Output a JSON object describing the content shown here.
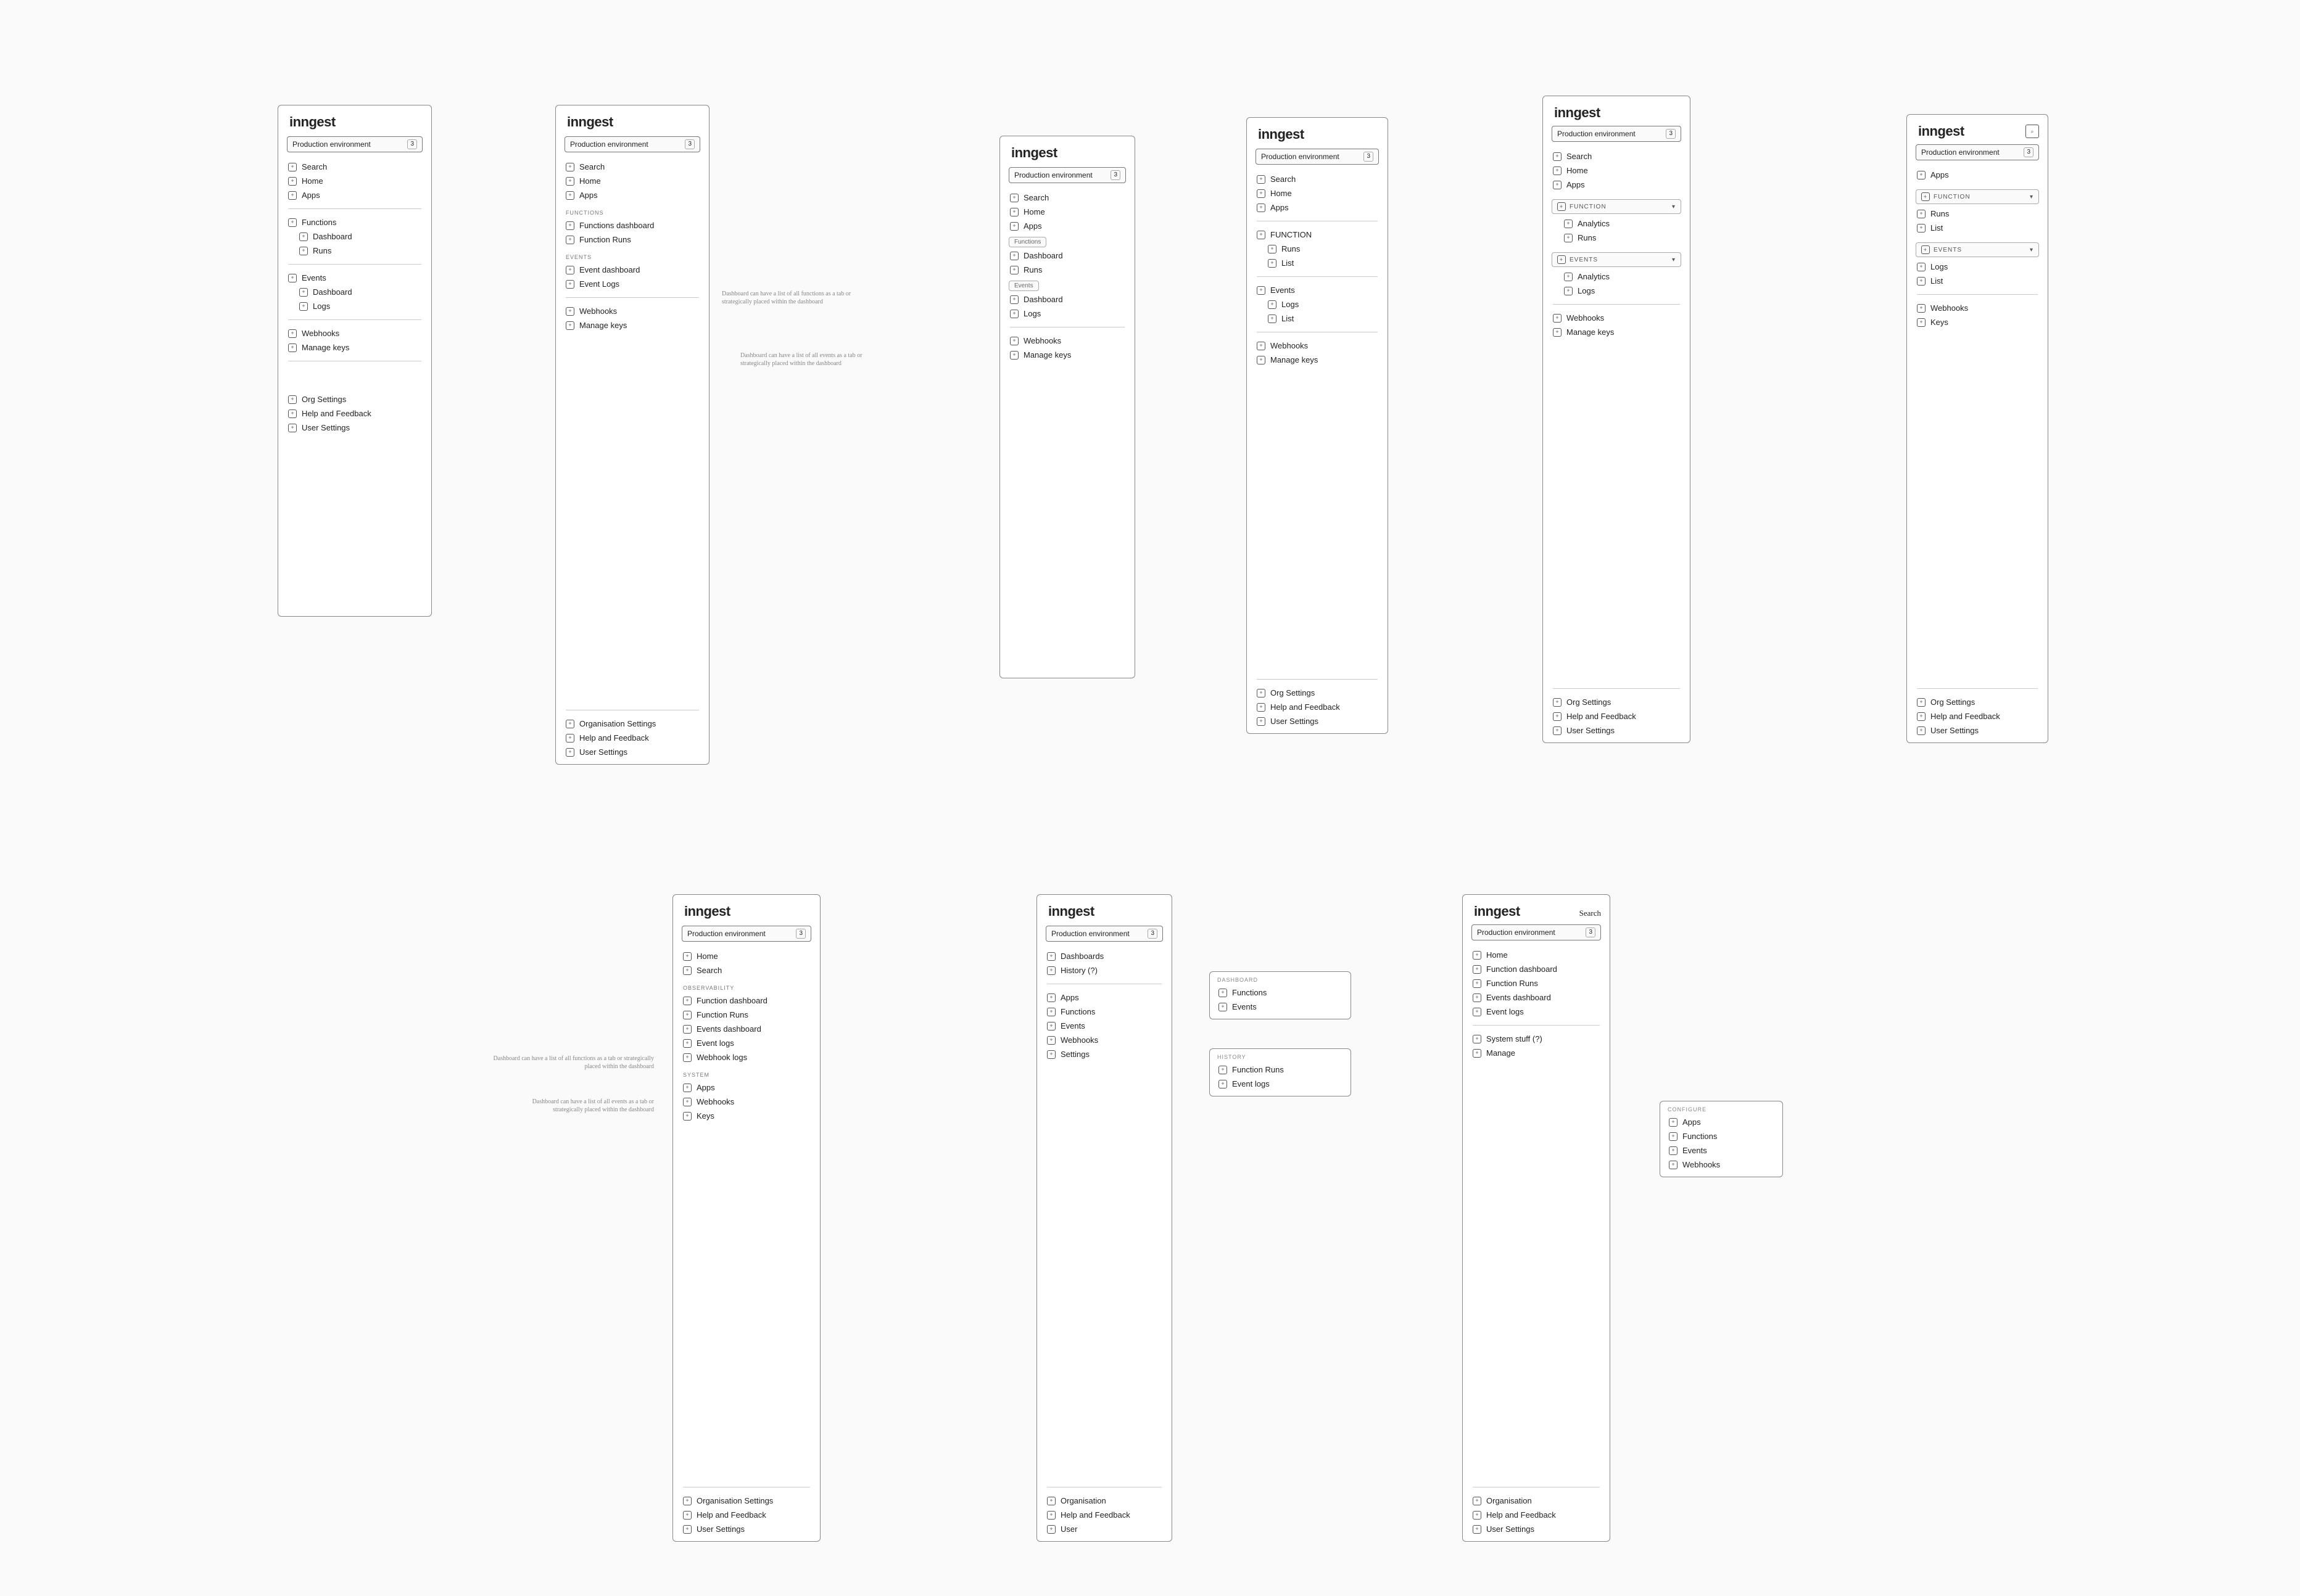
{
  "brand": "inngest",
  "env": {
    "label": "Production environment",
    "count": "3"
  },
  "nav": {
    "search": "Search",
    "home": "Home",
    "apps": "Apps",
    "functions": "Functions",
    "events": "Events",
    "dashboard": "Dashboard",
    "runs": "Runs",
    "list": "List",
    "logs": "Logs",
    "webhooks": "Webhooks",
    "manageKeys": "Manage keys",
    "keys": "Keys",
    "analytics": "Analytics",
    "functionsDashboard": "Functions dashboard",
    "functionDashboard": "Function dashboard",
    "functionRuns": "Function Runs",
    "eventDashboard": "Event dashboard",
    "eventsDashboard": "Events dashboard",
    "eventLogs": "Event Logs",
    "eventLogsLower": "Event logs",
    "webhookLogs": "Webhook logs",
    "dashboards": "Dashboards",
    "history": "History (?)",
    "systemStuff": "System stuff (?)",
    "manage": "Manage",
    "settings": "Settings"
  },
  "sectionLabels": {
    "functions": "FUNCTIONS",
    "function": "FUNCTION",
    "events": "EVENTS",
    "observability": "OBSERVABILITY",
    "system": "SYSTEM",
    "dashboard": "DASHBOARD",
    "history": "HISTORY",
    "configure": "CONFIGURE"
  },
  "footer": {
    "orgSettings": "Org Settings",
    "organisationSettings": "Organisation Settings",
    "organisation": "Organisation",
    "helpFeedback": "Help and Feedback",
    "userSettings": "User Settings",
    "user": "User"
  },
  "annotations": {
    "fnTab": "Dashboard can have a list of all functions as a tab or strategically placed within the dashboard",
    "evTab": "Dashboard can have a list of all events as a tab or strategically placed within the dashboard"
  },
  "popovers": {
    "dashboards": [
      "Functions",
      "Events"
    ],
    "history": [
      "Function Runs",
      "Event logs"
    ],
    "configure": [
      "Apps",
      "Functions",
      "Events",
      "Webhooks"
    ]
  }
}
